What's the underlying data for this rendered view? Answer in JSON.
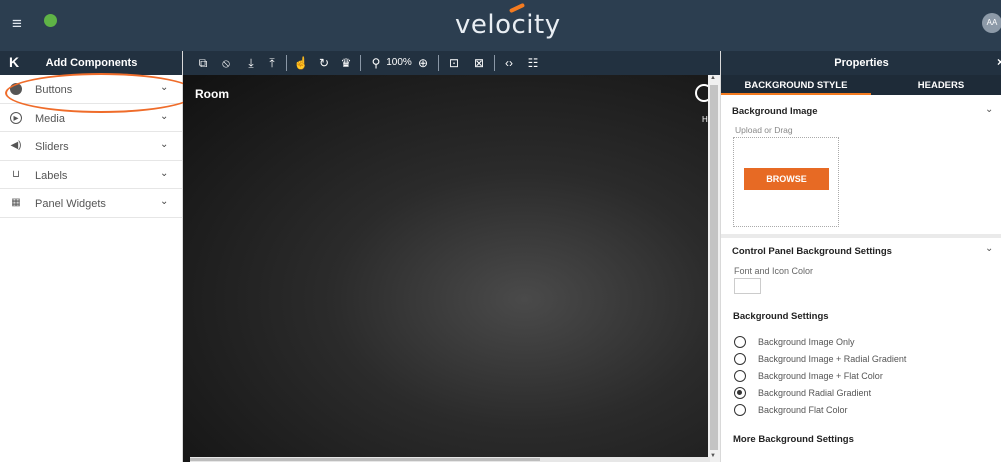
{
  "topbar": {
    "menu_icon": "hamburger-icon",
    "logo": "velocity",
    "avatar": "AA"
  },
  "left_panel": {
    "collapse_icon": "K",
    "title": "Add Components",
    "items": [
      {
        "label": "Buttons",
        "icon": "plus-circle-icon"
      },
      {
        "label": "Media",
        "icon": "play-circle-icon"
      },
      {
        "label": "Sliders",
        "icon": "volume-icon"
      },
      {
        "label": "Labels",
        "icon": "label-bracket-icon"
      },
      {
        "label": "Panel Widgets",
        "icon": "widgets-grid-icon"
      }
    ]
  },
  "toolbar": {
    "zoom": "100%",
    "icons": [
      "device-preview-icon",
      "disable-icon",
      "download-icon",
      "upload-icon",
      "touch-icon",
      "refresh-icon",
      "bulb-icon",
      "zoom-out-icon",
      "zoom-in-icon",
      "lock-icon",
      "grid-icon",
      "code-icon",
      "sliders-icon"
    ]
  },
  "canvas": {
    "title": "Room",
    "corner_label": "H"
  },
  "right_panel": {
    "title": "Properties",
    "close": "×",
    "tabs": [
      "BACKGROUND STYLE",
      "HEADERS"
    ],
    "bg_image": {
      "title": "Background Image",
      "upload_hint": "Upload or Drag",
      "browse": "BROWSE"
    },
    "cp_settings": {
      "title": "Control Panel Background Settings",
      "font_icon_color": "Font and Icon Color",
      "bg_settings_title": "Background Settings",
      "options": [
        {
          "label": "Background Image Only",
          "selected": false
        },
        {
          "label": "Background Image + Radial Gradient",
          "selected": false
        },
        {
          "label": "Background Image + Flat Color",
          "selected": false
        },
        {
          "label": "Background Radial Gradient",
          "selected": true
        },
        {
          "label": "Background Flat Color",
          "selected": false
        }
      ],
      "more_title": "More Background Settings"
    }
  },
  "colors": {
    "topbar": "#2c3e50",
    "panel_header": "#223140",
    "accent": "#f47b20",
    "highlight_ring": "#ef6c2a"
  }
}
